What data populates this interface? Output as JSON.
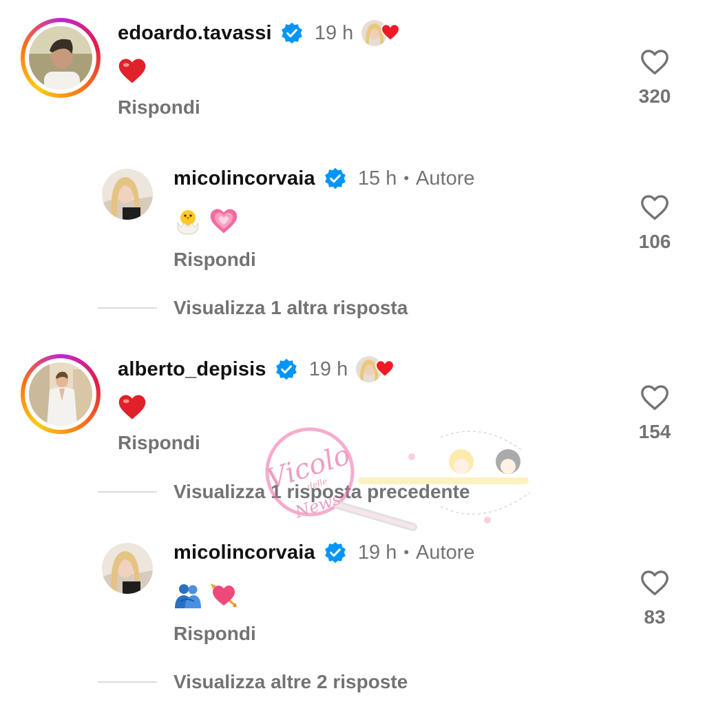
{
  "comments": [
    {
      "username": "edoardo.tavassi",
      "time": "19 h",
      "content_icons": [
        "red-heart-emoji"
      ],
      "reply_label": "Rispondi",
      "likes": "320",
      "liked_by_author": true
    },
    {
      "username": "micolincorvaia",
      "time": "15 h",
      "author_label": "Autore",
      "content_icons": [
        "hatching-chick-emoji",
        "growing-heart-emoji"
      ],
      "reply_label": "Rispondi",
      "likes": "106",
      "view_more": "Visualizza 1 altra risposta"
    },
    {
      "username": "alberto_depisis",
      "time": "19 h",
      "content_icons": [
        "red-heart-emoji"
      ],
      "reply_label": "Rispondi",
      "likes": "154",
      "liked_by_author": true,
      "view_more": "Visualizza 1 risposta precedente"
    },
    {
      "username": "micolincorvaia",
      "time": "19 h",
      "author_label": "Autore",
      "content_icons": [
        "people-hugging-emoji",
        "heart-with-arrow-emoji"
      ],
      "reply_label": "Rispondi",
      "likes": "83",
      "view_more": "Visualizza altre 2 risposte"
    }
  ],
  "watermark": {
    "text_main": "Vicolo",
    "text_small": "delle",
    "text_end": "News",
    "icon": "magnifying-glass-icon"
  },
  "colors": {
    "verified": "#0095f6",
    "heart": "#ed1c24",
    "muted": "#737373",
    "divider": "#dbdbdb"
  }
}
